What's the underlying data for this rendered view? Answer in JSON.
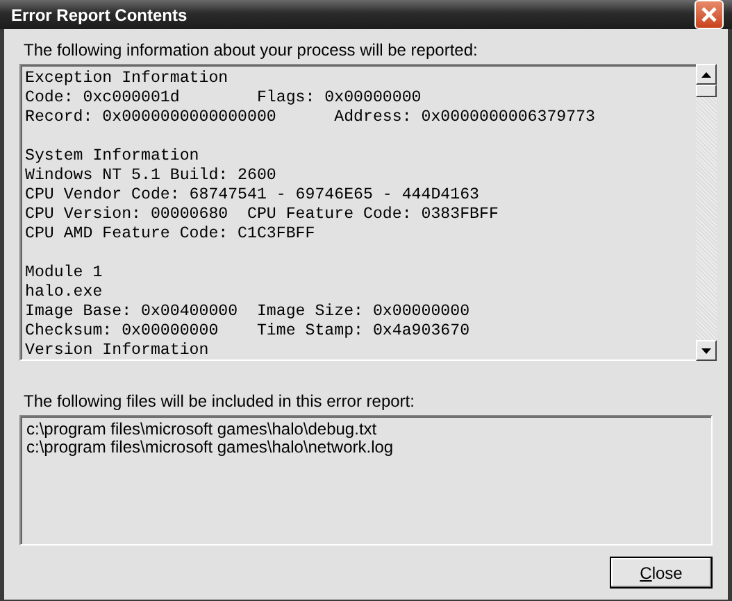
{
  "window": {
    "title": "Error Report Contents"
  },
  "report": {
    "label": "The following information about your process will be reported:",
    "sections": [
      {
        "lines": [
          "Exception Information",
          "Code: 0xc000001d        Flags: 0x00000000",
          "Record: 0x0000000000000000      Address: 0x0000000006379773"
        ]
      },
      {
        "lines": [
          "System Information",
          "Windows NT 5.1 Build: 2600",
          "CPU Vendor Code: 68747541 - 69746E65 - 444D4163",
          "CPU Version: 00000680  CPU Feature Code: 0383FBFF",
          "CPU AMD Feature Code: C1C3FBFF"
        ]
      },
      {
        "lines": [
          "Module 1",
          "halo.exe",
          "Image Base: 0x00400000  Image Size: 0x00000000",
          "Checksum: 0x00000000    Time Stamp: 0x4a903670",
          "Version Information"
        ]
      }
    ]
  },
  "files": {
    "label": "The following files will be included in this error report:",
    "items": [
      "c:\\program files\\microsoft games\\halo\\debug.txt",
      "c:\\program files\\microsoft games\\halo\\network.log"
    ]
  },
  "buttons": [
    {
      "label": "Close"
    }
  ]
}
